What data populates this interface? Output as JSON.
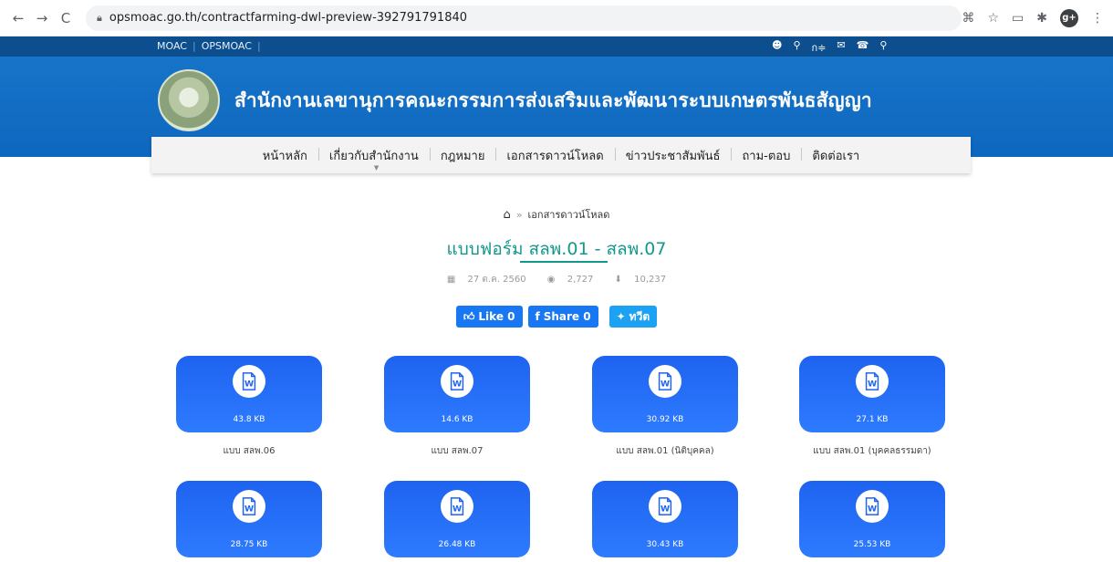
{
  "browser": {
    "url": "opsmoac.go.th/contractfarming-dwl-preview-392791791840",
    "back_icon": "←",
    "forward_icon": "→",
    "reload_icon": "C"
  },
  "topbar": {
    "left_links": [
      "MOAC",
      "OPSMOAC"
    ],
    "right_icons": [
      "user-icon",
      "search-icon",
      "font-size-icon",
      "mail-icon",
      "phone-icon",
      "location-icon"
    ],
    "font_label": "ก≑"
  },
  "header": {
    "title": "สำนักงานเลขานุการคณะกรรมการส่งเสริมและพัฒนาระบบเกษตรพันธสัญญา"
  },
  "nav": {
    "items": [
      "หน้าหลัก",
      "เกี่ยวกับสำนักงาน",
      "กฎหมาย",
      "เอกสารดาวน์โหลด",
      "ข่าวประชาสัมพันธ์",
      "ถาม-ตอบ",
      "ติดต่อเรา"
    ]
  },
  "breadcrumb": {
    "current": "เอกสารดาวน์โหลด"
  },
  "page": {
    "title": "แบบฟอร์ม สลพ.01 - สลพ.07",
    "date": "27 ต.ค. 2560",
    "views": "2,727",
    "downloads": "10,237"
  },
  "social": {
    "like_label": "Like 0",
    "share_label": "Share 0",
    "tweet_label": "ทวีต"
  },
  "files": [
    {
      "size": "43.8 KB",
      "name": "แบบ สลพ.06"
    },
    {
      "size": "14.6 KB",
      "name": "แบบ สลพ.07"
    },
    {
      "size": "30.92 KB",
      "name": "แบบ สลพ.01 (นิติบุคคล)"
    },
    {
      "size": "27.1 KB",
      "name": "แบบ สลพ.01 (บุคคลธรรมดา)"
    },
    {
      "size": "28.75 KB",
      "name": ""
    },
    {
      "size": "26.48 KB",
      "name": ""
    },
    {
      "size": "30.43 KB",
      "name": ""
    },
    {
      "size": "25.53 KB",
      "name": ""
    }
  ],
  "colors": {
    "banner": "#1674c9",
    "topstrip": "#0c4e8e",
    "title_accent": "#12998d",
    "card": "#2e7bff"
  }
}
